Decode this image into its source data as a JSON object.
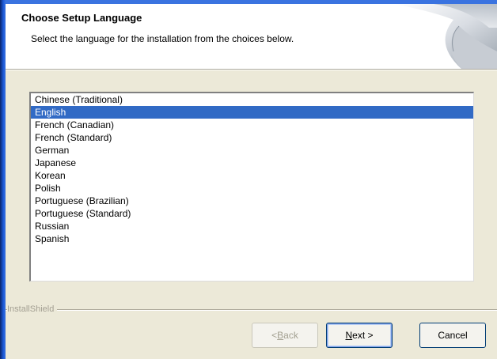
{
  "header": {
    "title": "Choose Setup Language",
    "subtitle": "Select the language for the installation from the choices below."
  },
  "language_list": {
    "selected": "English",
    "items": [
      "Chinese (Traditional)",
      "English",
      "French (Canadian)",
      "French (Standard)",
      "German",
      "Japanese",
      "Korean",
      "Polish",
      "Portuguese (Brazilian)",
      "Portuguese (Standard)",
      "Russian",
      "Spanish"
    ]
  },
  "brand": "InstallShield",
  "buttons": {
    "back": {
      "prefix": "< ",
      "accel": "B",
      "rest": "ack",
      "enabled": false
    },
    "next": {
      "accel": "N",
      "rest": "ext >",
      "enabled": true
    },
    "cancel": {
      "label": "Cancel",
      "enabled": true
    }
  },
  "colors": {
    "selection": "#316ac5",
    "dialog_background": "#ece9d8",
    "frame_blue": "#1c5ad8"
  }
}
